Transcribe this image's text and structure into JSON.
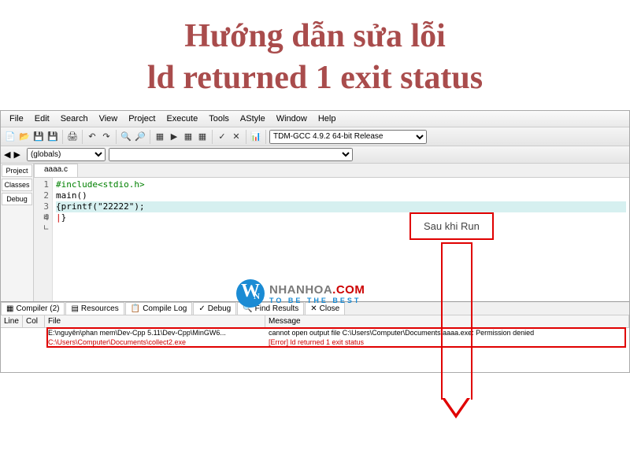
{
  "title": {
    "line1": "Hướng dẫn sửa lỗi",
    "line2": "ld returned 1 exit status"
  },
  "menubar": [
    "File",
    "Edit",
    "Search",
    "View",
    "Project",
    "Execute",
    "Tools",
    "AStyle",
    "Window",
    "Help"
  ],
  "compiler_profile": "TDM-GCC 4.9.2 64-bit Release",
  "scope_selector": "(globals)",
  "sidebar_tabs": [
    "Project",
    "Classes",
    "Debug"
  ],
  "file_tab": "aaaa.c",
  "code": {
    "1": "#include<stdio.h>",
    "2": "main()",
    "3": "{printf(\"22222\");",
    "4": "}"
  },
  "bottom_tabs": {
    "compiler": "Compiler (2)",
    "resources": "Resources",
    "compile_log": "Compile Log",
    "debug": "Debug",
    "find": "Find Results",
    "close": "Close"
  },
  "table_headers": {
    "line": "Line",
    "col": "Col",
    "file": "File",
    "message": "Message"
  },
  "rows": [
    {
      "file": "E:\\nguyên\\phan mem\\Dev-Cpp 5.11\\Dev-Cpp\\MinGW6...",
      "msg": "cannot open output file C:\\Users\\Computer\\Documents\\aaaa.exe: Permission denied"
    },
    {
      "file": "C:\\Users\\Computer\\Documents\\collect2.exe",
      "msg": "[Error] ld returned 1 exit status"
    }
  ],
  "annotation": "Sau khi Run",
  "watermark": {
    "brand1": "NHANHOA",
    "brand2": ".COM",
    "tagline": "TO BE THE BEST"
  }
}
